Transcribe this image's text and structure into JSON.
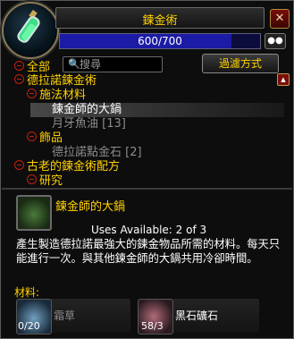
{
  "window": {
    "title": "鍊金術"
  },
  "skill": {
    "text": "600/700",
    "progress": 0.857
  },
  "filters": {
    "all_label": "全部",
    "search_placeholder": "搜尋",
    "filter_button": "過濾方式"
  },
  "tree": {
    "cat1": "德拉諾鍊金術",
    "sub1": "施法材料",
    "item1": "鍊金師的大鍋",
    "item2": "月牙魚油 [13]",
    "sub2": "飾品",
    "item3": "德拉諾點金石 [2]",
    "cat2": "古老的鍊金術配方",
    "sub3": "研究"
  },
  "detail": {
    "name": "鍊金師的大鍋",
    "uses": "Uses Available: 2 of 3",
    "description": "產生製造德拉諾最強大的鍊金物品所需的材料。每天只能進行一次。與其他鍊金師的大鍋共用冷卻時間。",
    "reagents_label": "材料:",
    "reagents": [
      {
        "name": "霜草",
        "count": "0/20",
        "icon": "frostweed-icon"
      },
      {
        "name": "黑石礦石",
        "count": "58/3",
        "icon": "blackrock-ore-icon"
      }
    ]
  },
  "colors": {
    "gold": "#ffd100",
    "gray": "#8b8b8b",
    "red": "#c41e10"
  }
}
